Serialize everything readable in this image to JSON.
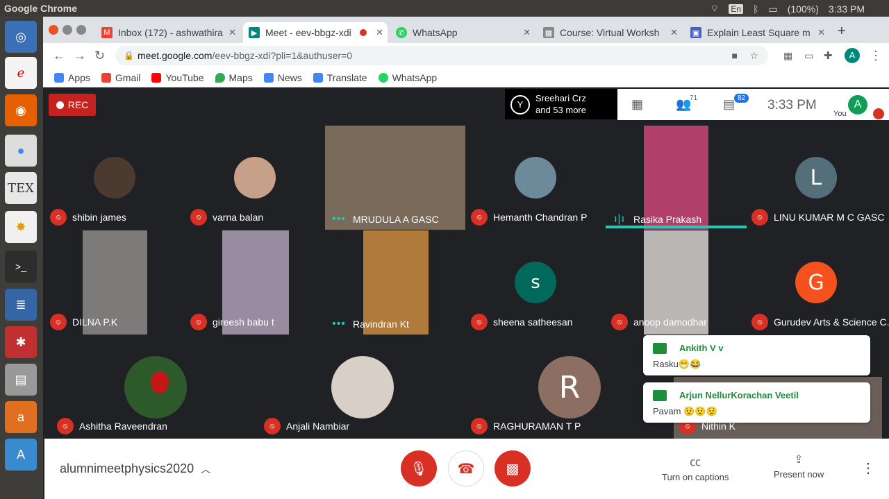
{
  "topbar": {
    "title": "Google Chrome",
    "lang": "En",
    "battery": "(100%)",
    "time": "3:33 PM"
  },
  "tabs": [
    {
      "label": "Inbox (172) - ashwathira",
      "icon": "gmail-icon",
      "color": "#ea4335"
    },
    {
      "label": "Meet - eev-bbgz-xdi",
      "icon": "meet-icon",
      "color": "#00897b"
    },
    {
      "label": "WhatsApp",
      "icon": "whatsapp-icon",
      "color": "#25d366"
    },
    {
      "label": "Course: Virtual Worksh",
      "icon": "moodle-icon",
      "color": "#888888"
    },
    {
      "label": "Explain Least Square m",
      "icon": "slides-icon",
      "color": "#4a5fc1"
    }
  ],
  "omnibox": {
    "host": "meet.google.com",
    "path": "/eev-bbgz-xdi?pli=1&authuser=0"
  },
  "bookmarks": [
    {
      "label": "Apps",
      "color": "#4285f4"
    },
    {
      "label": "Gmail",
      "color": "#ea4335"
    },
    {
      "label": "YouTube",
      "color": "#ff0000"
    },
    {
      "label": "Maps",
      "color": "#34a853"
    },
    {
      "label": "News",
      "color": "#4285f4"
    },
    {
      "label": "Translate",
      "color": "#4285f4"
    },
    {
      "label": "WhatsApp",
      "color": "#25d366"
    }
  ],
  "meet": {
    "rec": "REC",
    "presenter_line1": "Sreehari Crz",
    "presenter_line2": "and 53 more",
    "people_count": "71",
    "chat_count": "82",
    "time": "3:33  PM",
    "you": "You",
    "avatar_letter": "A"
  },
  "participants": [
    {
      "name": "shibin james"
    },
    {
      "name": "varna balan"
    },
    {
      "name": "MRUDULA A GASC"
    },
    {
      "name": "Hemanth Chandran P"
    },
    {
      "name": "Rasika Prakash"
    },
    {
      "name": "LINU KUMAR M C GASC",
      "letter": "L"
    },
    {
      "name": "DILNA P.K"
    },
    {
      "name": "gireesh babu t"
    },
    {
      "name": "Ravindran Kt"
    },
    {
      "name": "sheena satheesan",
      "letter": "S"
    },
    {
      "name": "anoop damodhar"
    },
    {
      "name": "Gurudev Arts & Science C...",
      "letter": "G"
    },
    {
      "name": "Ashitha Raveendran"
    },
    {
      "name": "Anjali Nambiar"
    },
    {
      "name": "RAGHURAMAN T P",
      "letter": "R"
    },
    {
      "name": "Nithin K"
    }
  ],
  "notifications": [
    {
      "who": "Ankith V v",
      "msg": "Rasku😁😂"
    },
    {
      "who": "Arjun NellurKorachan Veetil",
      "msg": "Pavam 😟😟😟"
    }
  ],
  "bottom": {
    "meeting_code": "alumnimeetphysics2020",
    "captions": "Turn on captions",
    "present": "Present now"
  }
}
